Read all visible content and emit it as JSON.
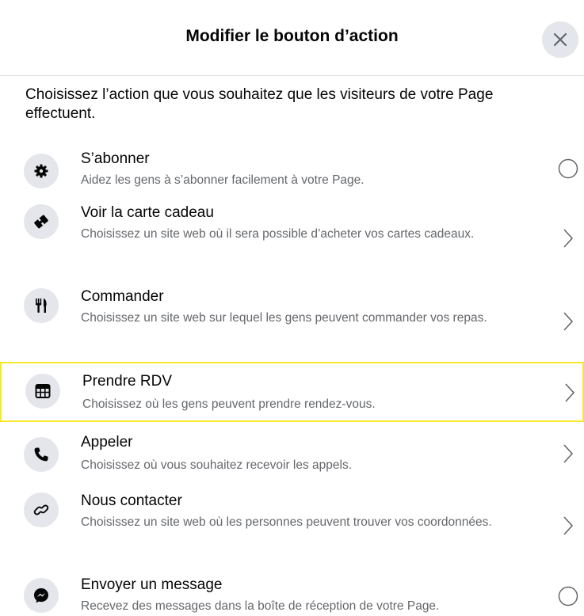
{
  "dialog": {
    "title": "Modifier le bouton d’action",
    "intro": "Choisissez l’action que vous souhaitez que les visiteurs de votre Page effectuent."
  },
  "items": [
    {
      "title": "S’abonner",
      "desc": "Aidez les gens à s’abonner facilement à votre Page.",
      "icon": "gear-icon",
      "control": "radio"
    },
    {
      "title": "Voir la carte cadeau",
      "desc": "Choisissez un site web où il sera possible d’acheter vos cartes cadeaux.",
      "icon": "gift-card-icon",
      "control": "chevron"
    },
    {
      "title": "Commander",
      "desc": "Choisissez un site web sur lequel les gens peuvent commander vos repas.",
      "icon": "utensils-icon",
      "control": "chevron"
    },
    {
      "title": "Prendre RDV",
      "desc": "Choisissez où les gens peuvent prendre rendez-vous.",
      "icon": "calendar-icon",
      "control": "chevron",
      "highlighted": true
    },
    {
      "title": "Appeler",
      "desc": "Choisissez où vous souhaitez recevoir les appels.",
      "icon": "phone-icon",
      "control": "chevron"
    },
    {
      "title": "Nous contacter",
      "desc": "Choisissez un site web où les personnes peuvent trouver vos coordonnées.",
      "icon": "link-icon",
      "control": "chevron"
    },
    {
      "title": "Envoyer un message",
      "desc": "Recevez des messages dans la boîte de réception de votre Page.",
      "icon": "messenger-icon",
      "control": "radio"
    }
  ],
  "colors": {
    "highlight": "#f7e82a",
    "icon_bg": "#e4e6eb",
    "secondary_text": "#65676b"
  }
}
